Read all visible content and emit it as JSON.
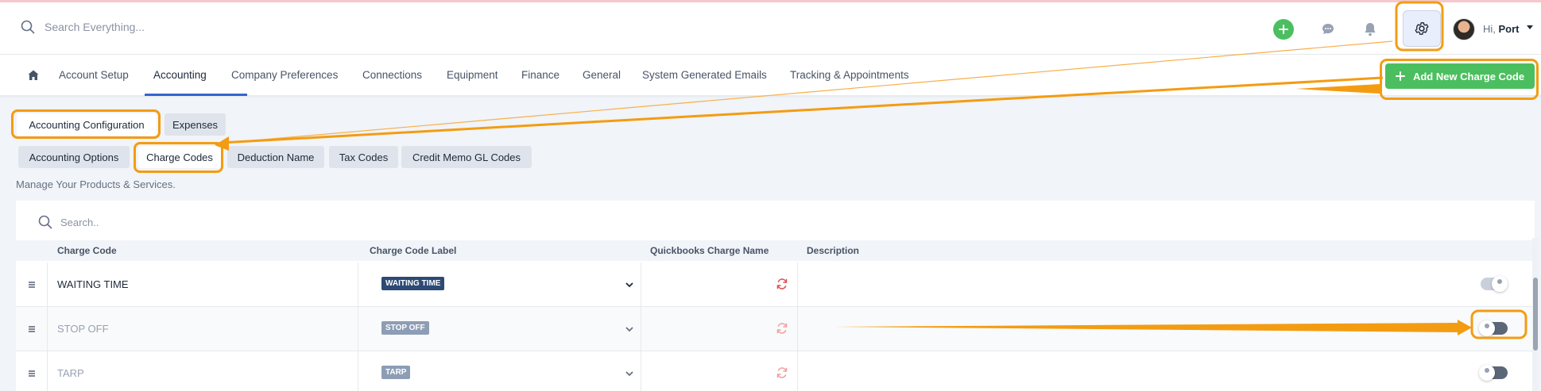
{
  "header": {
    "search_placeholder": "Search Everything...",
    "greeting": "Hi,",
    "user_name": "Port"
  },
  "nav": {
    "tabs": [
      {
        "label": "Account Setup"
      },
      {
        "label": "Accounting"
      },
      {
        "label": "Company Preferences"
      },
      {
        "label": "Connections"
      },
      {
        "label": "Equipment"
      },
      {
        "label": "Finance"
      },
      {
        "label": "General"
      },
      {
        "label": "System Generated Emails"
      },
      {
        "label": "Tracking & Appointments"
      }
    ],
    "active_tab": "Accounting"
  },
  "actions": {
    "add_charge_code": "Add New Charge Code"
  },
  "section_tabs": [
    "Accounting Configuration",
    "Expenses"
  ],
  "sub_tabs": [
    "Accounting Options",
    "Charge Codes",
    "Deduction Name",
    "Tax Codes",
    "Credit Memo GL Codes"
  ],
  "page": {
    "subtitle": "Manage Your Products & Services."
  },
  "table": {
    "search_placeholder": "Search..",
    "columns": [
      "Charge Code",
      "Charge Code Label",
      "Quickbooks Charge Name",
      "Description"
    ],
    "rows": [
      {
        "code": "WAITING TIME",
        "label": "WAITING TIME",
        "quickbooks": "",
        "description": "",
        "enabled": true
      },
      {
        "code": "STOP OFF",
        "label": "STOP OFF",
        "quickbooks": "",
        "description": "",
        "enabled": false
      },
      {
        "code": "TARP",
        "label": "TARP",
        "quickbooks": "",
        "description": "",
        "enabled": false
      }
    ]
  },
  "colors": {
    "accent": "#3366cc",
    "success": "#4bbf5f",
    "highlight": "#f39c12",
    "badge": "#2c4a74"
  }
}
